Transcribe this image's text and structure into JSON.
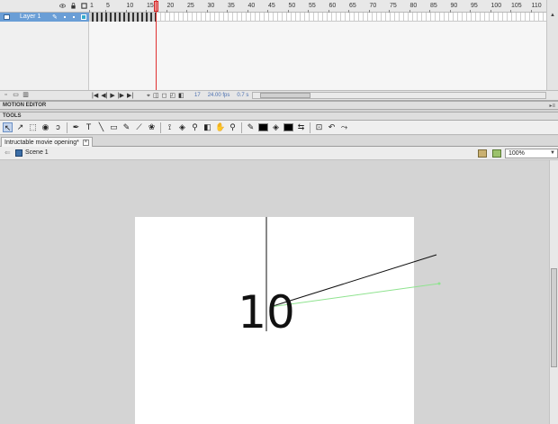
{
  "timeline": {
    "ruler_numbers": [
      "1",
      "5",
      "10",
      "15",
      "20",
      "25",
      "30",
      "35",
      "40",
      "45",
      "50",
      "55",
      "60",
      "65",
      "70",
      "75",
      "80",
      "85",
      "90",
      "95",
      "100",
      "105",
      "110"
    ],
    "layer_name": "Layer 1",
    "current_frame": "17",
    "frame_rate": "24.00",
    "frame_rate_unit": "fps",
    "elapsed": "0.7 s",
    "playhead_frame": 17
  },
  "panels": {
    "motion_editor": "MOTION EDITOR",
    "tools": "TOOLS"
  },
  "document": {
    "tab_title": "Intructable movie opening*",
    "scene": "Scene 1",
    "zoom": "100%"
  },
  "stage": {
    "text": "10"
  },
  "colors": {
    "layer_highlight": "#6a9ed6",
    "playhead": "#e03030",
    "stage": "#ffffff",
    "workspace": "#d4d4d4",
    "guide_line": "#8fe38f"
  }
}
